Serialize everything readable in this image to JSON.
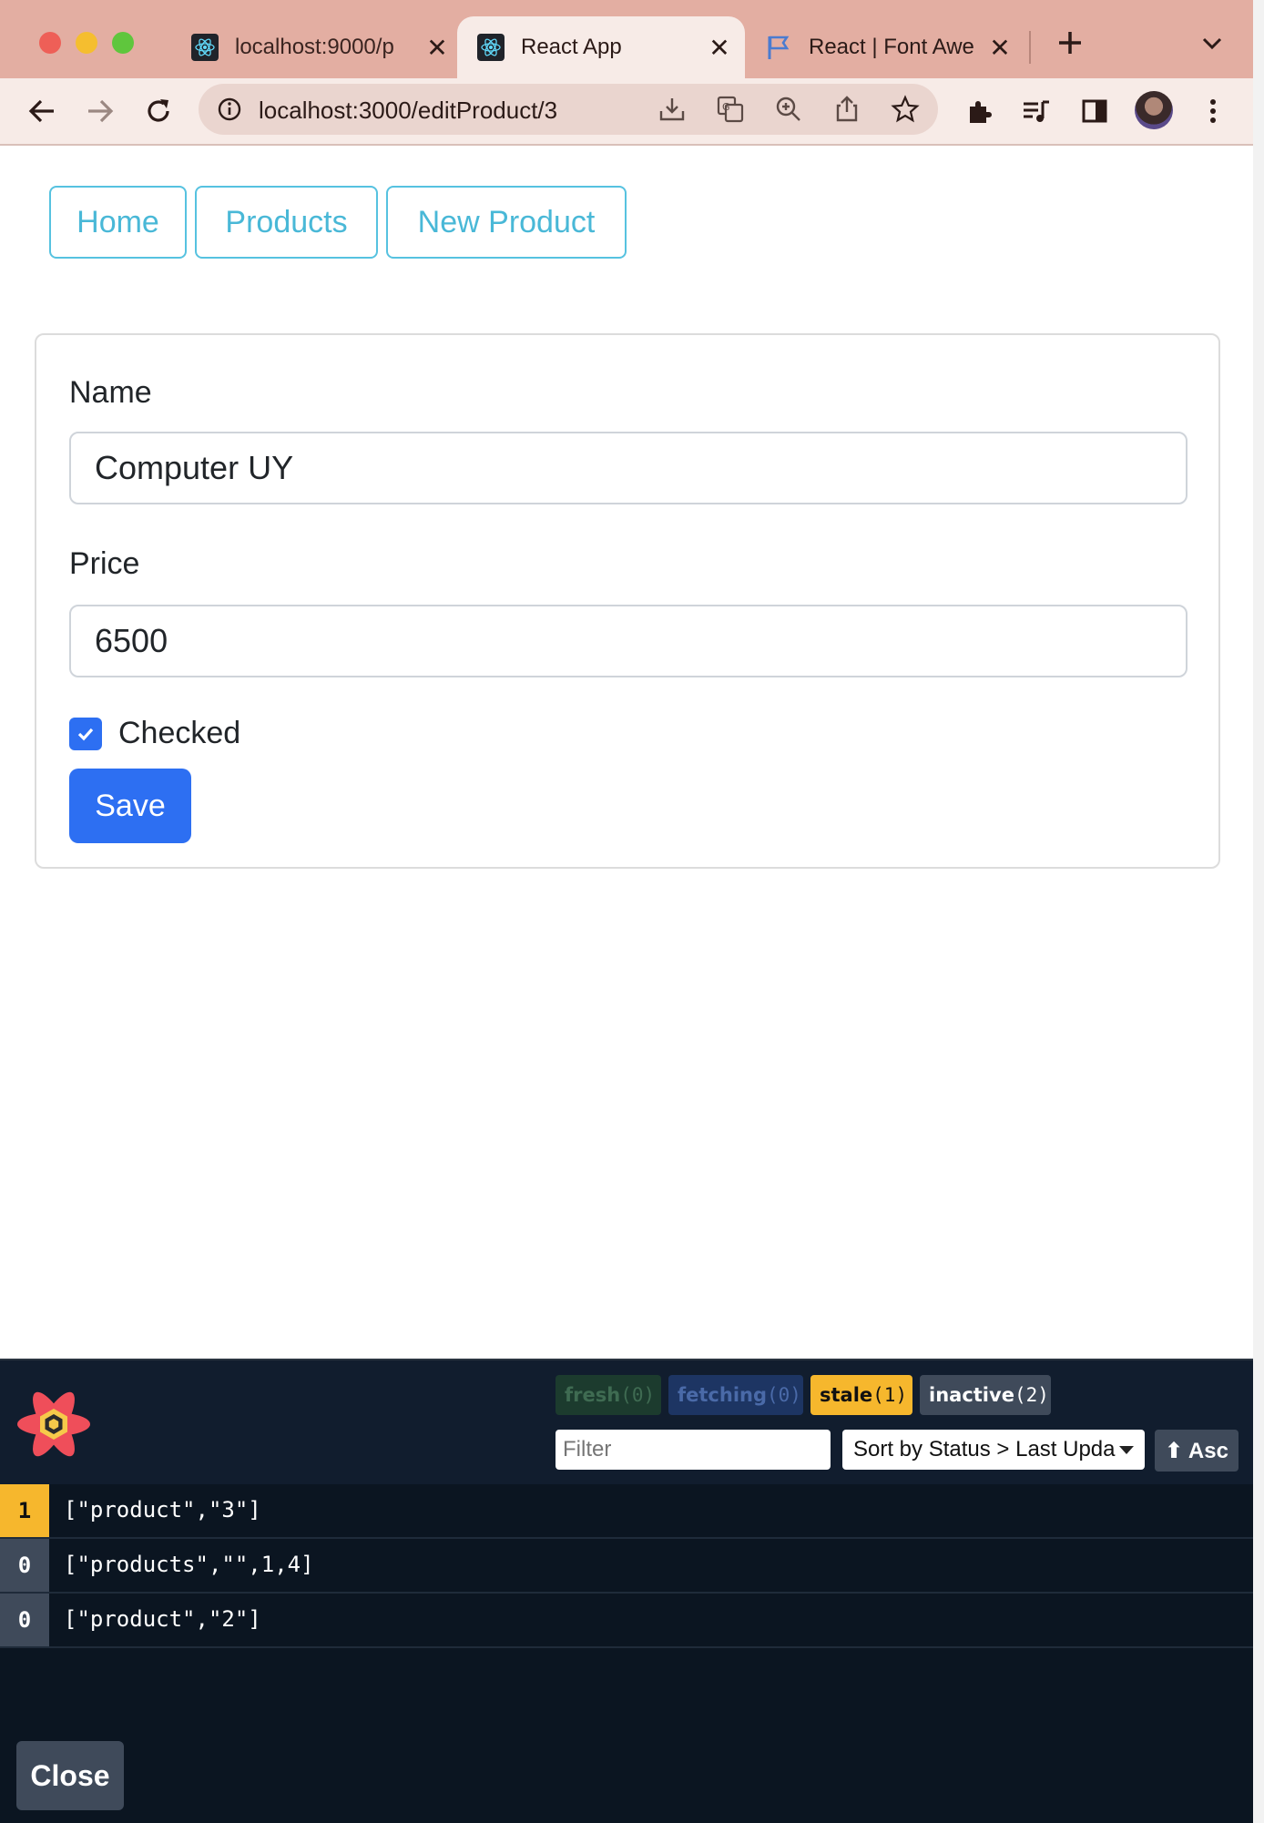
{
  "browser": {
    "tabs": [
      {
        "title": "localhost:9000/p",
        "icon": "react-icon",
        "active": false
      },
      {
        "title": "React App",
        "icon": "react-icon",
        "active": true
      },
      {
        "title": "React | Font Awe",
        "icon": "flag-icon",
        "active": false
      }
    ],
    "close_glyph": "✕",
    "url": "localhost:3000/editProduct/3"
  },
  "nav": {
    "home": "Home",
    "products": "Products",
    "new_product": "New Product"
  },
  "form": {
    "name_label": "Name",
    "name_value": "Computer UY",
    "price_label": "Price",
    "price_value": "6500",
    "checked_label": "Checked",
    "checked": true,
    "save_label": "Save"
  },
  "devtools": {
    "status": {
      "fresh": {
        "label": "fresh",
        "count": "(0)",
        "color": "#1c3b2e"
      },
      "fetching": {
        "label": "fetching",
        "count": "(0)",
        "color": "#1d3563"
      },
      "stale": {
        "label": "stale",
        "count": "(1)",
        "color": "#f6b72d"
      },
      "inactive": {
        "label": "inactive",
        "count": "(2)",
        "color": "#3f4a5a"
      }
    },
    "filter_placeholder": "Filter",
    "sort_label": "Sort by Status > Last Upda",
    "asc_label": "⬆ Asc",
    "queries": [
      {
        "count": "1",
        "key": "[\"product\",\"3\"]",
        "status": "stale"
      },
      {
        "count": "0",
        "key": "[\"products\",\"\",1,4]",
        "status": "inactive"
      },
      {
        "count": "0",
        "key": "[\"product\",\"2\"]",
        "status": "inactive"
      }
    ],
    "close_label": "Close"
  },
  "colors": {
    "tabbar": "#e3aea2",
    "toolbar": "#f7ebe7",
    "nav_outline": "#56c2e0",
    "primary": "#2d6ff2",
    "devtools_bg": "#0b1521",
    "stale": "#f6b72d"
  }
}
